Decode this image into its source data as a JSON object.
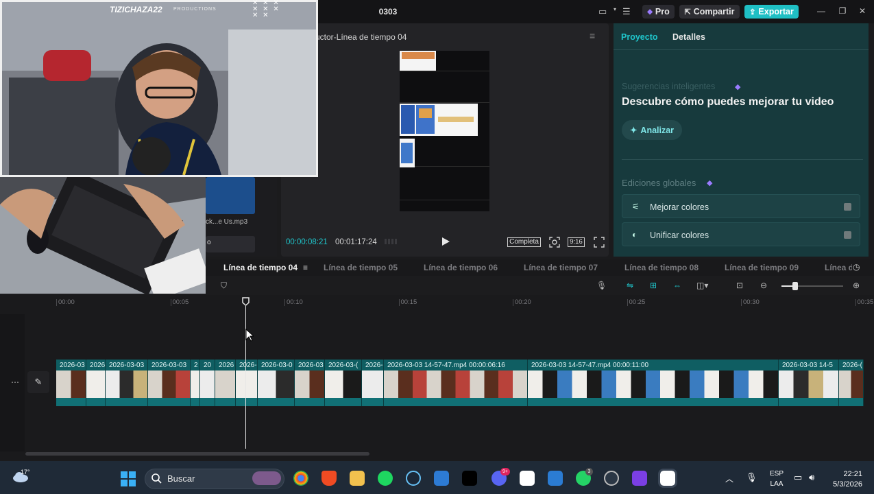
{
  "titlebar": {
    "project_name": "0303",
    "pro_label": "Pro",
    "share_label": "Compartir",
    "export_label": "Exportar"
  },
  "media": {
    "audio_file": "ck...e Us.mp3",
    "item2_label": "o"
  },
  "player": {
    "title": "uctor-Línea de tiempo 04",
    "time_current": "00:00:08:21",
    "time_total": "00:01:17:24",
    "completa_label": "Completa",
    "ratio_label": "9:16"
  },
  "right_panel": {
    "tabs": [
      "Proyecto",
      "Detalles"
    ],
    "suggestions_label": "Sugerencias inteligentes",
    "headline": "Descubre cómo puedes mejorar tu video",
    "analyze_label": "Analizar",
    "global_label": "Ediciones globales",
    "options": [
      {
        "label": "Mejorar colores",
        "icon": "magic-wand-icon"
      },
      {
        "label": "Unificar colores",
        "icon": "color-unify-icon"
      }
    ]
  },
  "timeline": {
    "tabs": [
      "Línea de tiempo 04",
      "Línea de tiempo 05",
      "Línea de tiempo 06",
      "Línea de tiempo 07",
      "Línea de tiempo 08",
      "Línea de tiempo 09",
      "Línea d"
    ],
    "ruler": [
      "00:00",
      "00:05",
      "00:10",
      "00:15",
      "00:20",
      "00:25",
      "00:30",
      "00:35"
    ],
    "clips": [
      "2026-03",
      "2026",
      "2026-03-03",
      "2026-03-03",
      "2",
      "20",
      "2026",
      "2026-",
      "2026-03-0",
      "2026-03",
      "2026-03-(",
      "2026-(",
      "2026-03-03 14-57-47.mp4   00:00:06:16",
      "2026-03-03 14-57-47.mp4   00:00:11:00",
      "2026-03-03 14-5",
      "2026-("
    ]
  },
  "webcam": {
    "streamer_name": "TIZICHAZA22",
    "productions": "PRODUCTIONS",
    "marks": "✕ ✕ ✕ ✕ ✕ ✕ ✕ ✕"
  },
  "taskbar": {
    "weather_temp": "17°",
    "search_placeholder": "Buscar",
    "lang_line1": "ESP",
    "lang_line2": "LAA",
    "time": "22:21",
    "date": "5/3/2026",
    "discord_badge": "9+",
    "whatsapp_badge": "3"
  },
  "colors": {
    "accent": "#1fc6cc",
    "export": "#1fbfc4",
    "clip_teal": "#0f5e62",
    "right_panel_bg": "#173a3d"
  }
}
